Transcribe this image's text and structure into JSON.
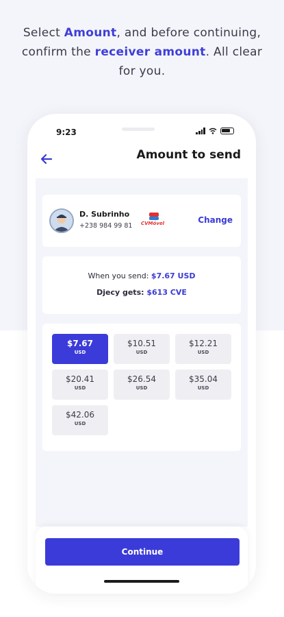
{
  "headline": {
    "p1": "Select ",
    "h1": "Amount",
    "p2": ", and before continuing, confirm the ",
    "h2": "receiver amount",
    "p3": ". All clear for you."
  },
  "status_bar": {
    "time": "9:23"
  },
  "nav": {
    "title": "Amount to send",
    "back_icon": "arrow-left-icon"
  },
  "receiver": {
    "name": "D. Subrinho",
    "phone": "+238 984 99 81",
    "provider": "CVMóvel",
    "change_label": "Change"
  },
  "summary": {
    "send_label": "When you send: ",
    "send_value": "$7.67 USD",
    "gets_label": "Djecy gets: ",
    "gets_value": "$613 CVE"
  },
  "amounts": [
    {
      "value": "$7.67",
      "currency": "USD",
      "selected": true
    },
    {
      "value": "$10.51",
      "currency": "USD",
      "selected": false
    },
    {
      "value": "$12.21",
      "currency": "USD",
      "selected": false
    },
    {
      "value": "$20.41",
      "currency": "USD",
      "selected": false
    },
    {
      "value": "$26.54",
      "currency": "USD",
      "selected": false
    },
    {
      "value": "$35.04",
      "currency": "USD",
      "selected": false
    },
    {
      "value": "$42.06",
      "currency": "USD",
      "selected": false
    }
  ],
  "footer": {
    "continue_label": "Continue"
  },
  "colors": {
    "accent": "#3b3bd9",
    "background": "#f4f5fa"
  }
}
